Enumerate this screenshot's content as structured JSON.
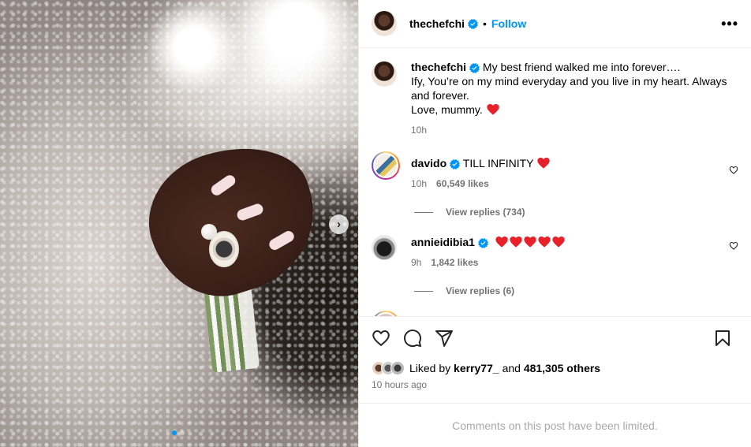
{
  "post": {
    "author": "thechefchi",
    "follow_label": "Follow",
    "separator": "•",
    "more_label": "•••",
    "caption": {
      "line1": "My best friend walked me into forever….",
      "line2": "Ify, You’re on my mind everyday and you live in my heart. Always and forever.",
      "line3": "Love, mummy.",
      "time": "10h"
    },
    "comments": [
      {
        "username": "davido",
        "text": "TILL INFINITY",
        "time": "10h",
        "likes": "60,549 likes",
        "view_replies": "View replies (734)"
      },
      {
        "username": "annieidibia1",
        "text": "",
        "time": "9h",
        "likes": "1,842 likes",
        "view_replies": "View replies (6)"
      }
    ],
    "liked_by_prefix": "Liked by",
    "liked_by_user": "kerry77_",
    "liked_by_and": "and",
    "liked_by_others": "481,305 others",
    "posted_ago": "10 hours ago",
    "comments_limited": "Comments on this post have been limited."
  },
  "carousel": {
    "next_icon": "chevron-right-icon",
    "total_slides": 2,
    "current_slide": 1
  },
  "colors": {
    "accent": "#0095f6",
    "heart_red": "#ff3040",
    "muted_text": "#737373",
    "divider": "#efefef"
  },
  "icons": {
    "like": "heart-outline-icon",
    "comment": "speech-bubble-icon",
    "share": "paper-plane-icon",
    "save": "bookmark-icon",
    "verified": "verified-badge-icon",
    "more": "more-options-icon"
  }
}
